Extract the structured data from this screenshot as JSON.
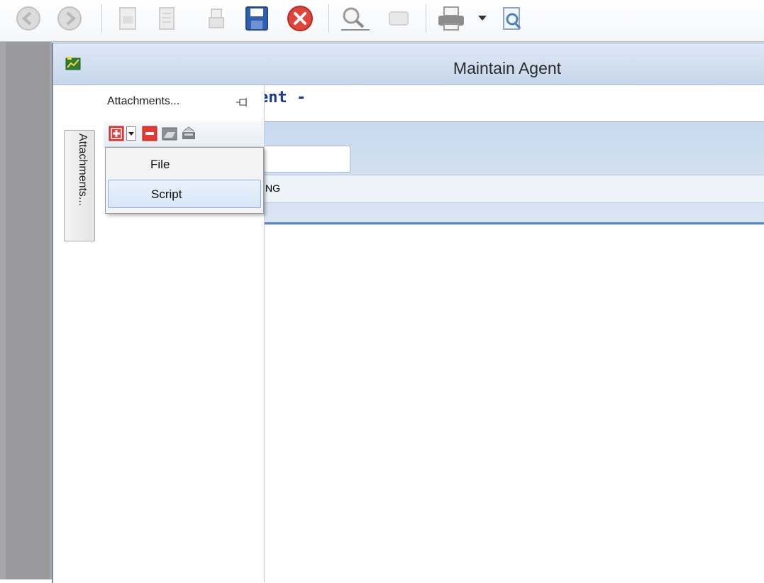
{
  "window": {
    "title": "Maintain Agent"
  },
  "form": {
    "header_fragment": "ent -",
    "row_fragment": "NG"
  },
  "side_tab": {
    "label": "Attachments..."
  },
  "attachments": {
    "title": "Attachments...",
    "toolbar_icons": [
      "add-icon",
      "dropdown-arrow-icon",
      "remove-icon",
      "open-folder-icon",
      "scanner-icon"
    ]
  },
  "menu": {
    "items": [
      {
        "label": "File"
      },
      {
        "label": "Script"
      }
    ],
    "highlighted": 1
  },
  "toolbar": {
    "icons": [
      "back-icon",
      "forward-icon",
      "document-icon",
      "notes-icon",
      "print-preview-icon",
      "save-icon",
      "close-icon",
      "search-icon",
      "refresh-icon",
      "print-icon",
      "dropdown-arrow-icon",
      "zoom-document-icon"
    ]
  },
  "colors": {
    "accent": "#1c3a8a",
    "panel": "#c9d9ee",
    "close_red": "#e0443a",
    "save_blue": "#2f5fb3"
  }
}
